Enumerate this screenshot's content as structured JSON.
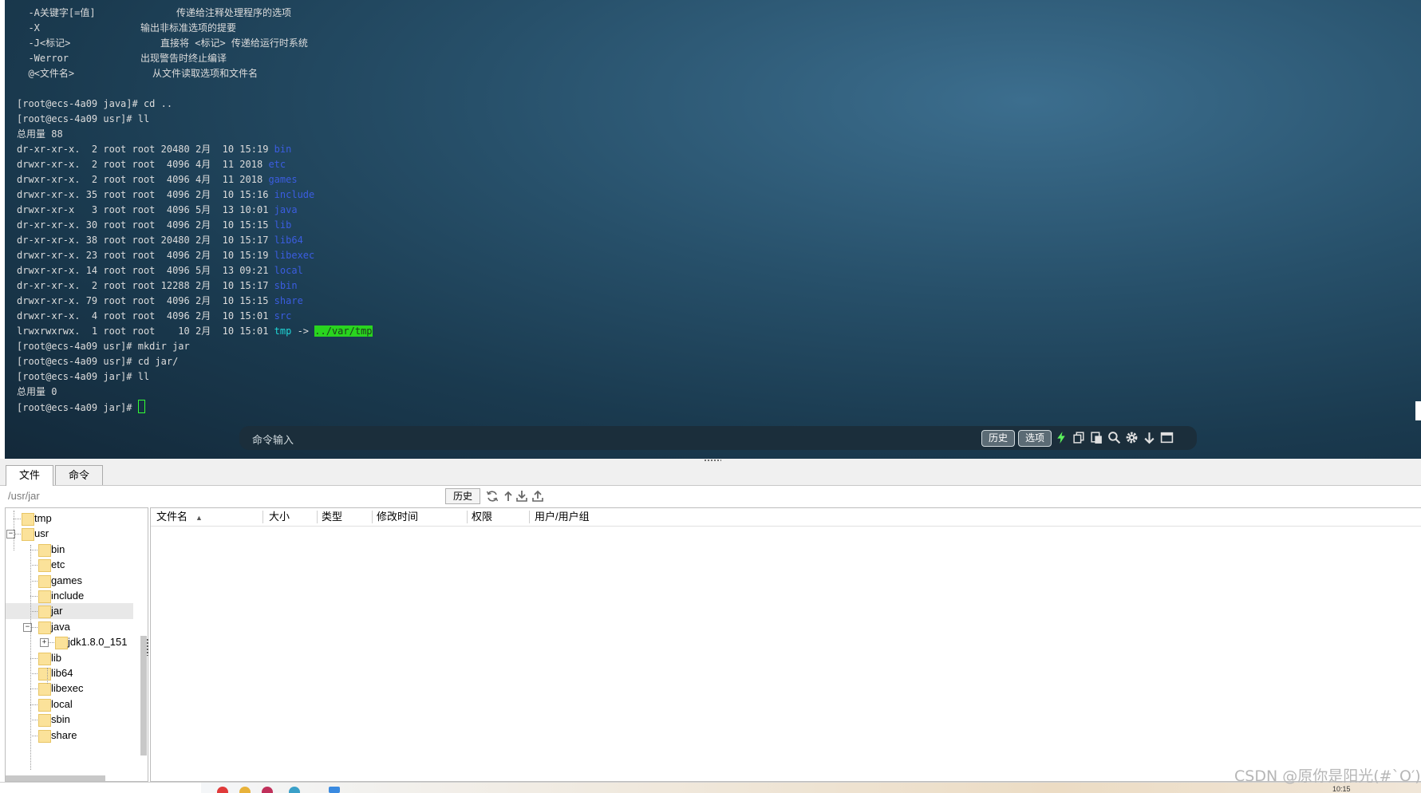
{
  "terminal": {
    "help_lines": [
      {
        "opt": "  -A关键字[=值]",
        "desc": "传递给注释处理程序的选项"
      },
      {
        "opt": "  -X",
        "desc": "输出非标准选项的提要"
      },
      {
        "opt": "  -J<标记>",
        "desc": "直接将 <标记> 传递给运行时系统"
      },
      {
        "opt": "  -Werror",
        "desc": "出现警告时终止编译"
      },
      {
        "opt": "  @<文件名>",
        "desc": "从文件读取选项和文件名"
      }
    ],
    "cmd_cd_up": "[root@ecs-4a09 java]# cd ..",
    "cmd_ll_usr": "[root@ecs-4a09 usr]# ll",
    "total_usr": "总用量 88",
    "listing": [
      {
        "meta": "dr-xr-xr-x.  2 root root 20480 2月  10 15:19 ",
        "name": "bin",
        "kind": "dir"
      },
      {
        "meta": "drwxr-xr-x.  2 root root  4096 4月  11 2018 ",
        "name": "etc",
        "kind": "dir"
      },
      {
        "meta": "drwxr-xr-x.  2 root root  4096 4月  11 2018 ",
        "name": "games",
        "kind": "dir"
      },
      {
        "meta": "drwxr-xr-x. 35 root root  4096 2月  10 15:16 ",
        "name": "include",
        "kind": "dir"
      },
      {
        "meta": "drwxr-xr-x   3 root root  4096 5月  13 10:01 ",
        "name": "java",
        "kind": "dir"
      },
      {
        "meta": "dr-xr-xr-x. 30 root root  4096 2月  10 15:15 ",
        "name": "lib",
        "kind": "dir"
      },
      {
        "meta": "dr-xr-xr-x. 38 root root 20480 2月  10 15:17 ",
        "name": "lib64",
        "kind": "dir"
      },
      {
        "meta": "drwxr-xr-x. 23 root root  4096 2月  10 15:19 ",
        "name": "libexec",
        "kind": "dir"
      },
      {
        "meta": "drwxr-xr-x. 14 root root  4096 5月  13 09:21 ",
        "name": "local",
        "kind": "dir"
      },
      {
        "meta": "dr-xr-xr-x.  2 root root 12288 2月  10 15:17 ",
        "name": "sbin",
        "kind": "dir"
      },
      {
        "meta": "drwxr-xr-x. 79 root root  4096 2月  10 15:15 ",
        "name": "share",
        "kind": "dir"
      },
      {
        "meta": "drwxr-xr-x.  4 root root  4096 2月  10 15:01 ",
        "name": "src",
        "kind": "dir"
      }
    ],
    "link_line": {
      "meta": "lrwxrwxrwx.  1 root root    10 2月  10 15:01 ",
      "name": "tmp",
      "arrow": " -> ",
      "target": "../var/tmp"
    },
    "cmd_mkdir": "[root@ecs-4a09 usr]# mkdir jar",
    "cmd_cd_jar": "[root@ecs-4a09 usr]# cd jar/",
    "cmd_ll_jar": "[root@ecs-4a09 jar]# ll",
    "total_jar": "总用量 0",
    "prompt": "[root@ecs-4a09 jar]# "
  },
  "command_bar": {
    "placeholder": "命令输入",
    "history_label": "历史",
    "options_label": "选项",
    "icons": [
      "lightning-icon",
      "copy-icon",
      "paste-icon",
      "search-icon",
      "gear-icon",
      "download-arrow-icon",
      "window-icon"
    ]
  },
  "tabs": [
    {
      "label": "文件",
      "active": true
    },
    {
      "label": "命令",
      "active": false
    }
  ],
  "path": {
    "value": "/usr/jar",
    "history_label": "历史"
  },
  "tree": {
    "nodes": [
      {
        "label": "tmp",
        "depth": 0
      },
      {
        "label": "usr",
        "depth": 0,
        "expanded": true
      },
      {
        "label": "bin",
        "depth": 1
      },
      {
        "label": "etc",
        "depth": 1
      },
      {
        "label": "games",
        "depth": 1
      },
      {
        "label": "include",
        "depth": 1
      },
      {
        "label": "jar",
        "depth": 1,
        "selected": true
      },
      {
        "label": "java",
        "depth": 1,
        "expanded": true
      },
      {
        "label": "jdk1.8.0_151",
        "depth": 2,
        "collapsed": true
      },
      {
        "label": "lib",
        "depth": 1
      },
      {
        "label": "lib64",
        "depth": 1
      },
      {
        "label": "libexec",
        "depth": 1
      },
      {
        "label": "local",
        "depth": 1
      },
      {
        "label": "sbin",
        "depth": 1
      },
      {
        "label": "share",
        "depth": 1
      }
    ]
  },
  "file_list": {
    "columns": [
      "文件名",
      "大小",
      "类型",
      "修改时间",
      "权限",
      "用户/用户组"
    ],
    "sort_indicator": "▲",
    "rows": []
  },
  "taskbar": {
    "clock": "10:15"
  },
  "watermark": "CSDN @原你是阳光(#`O′)",
  "colors": {
    "terminal_text": "#dcdcdc",
    "dir_blue": "#3b5de0",
    "link_cyan": "#1fd7d7",
    "link_target_bg": "#29d41f",
    "cursor_green": "#33ff33",
    "folder_yellow": "#fbe29a"
  }
}
